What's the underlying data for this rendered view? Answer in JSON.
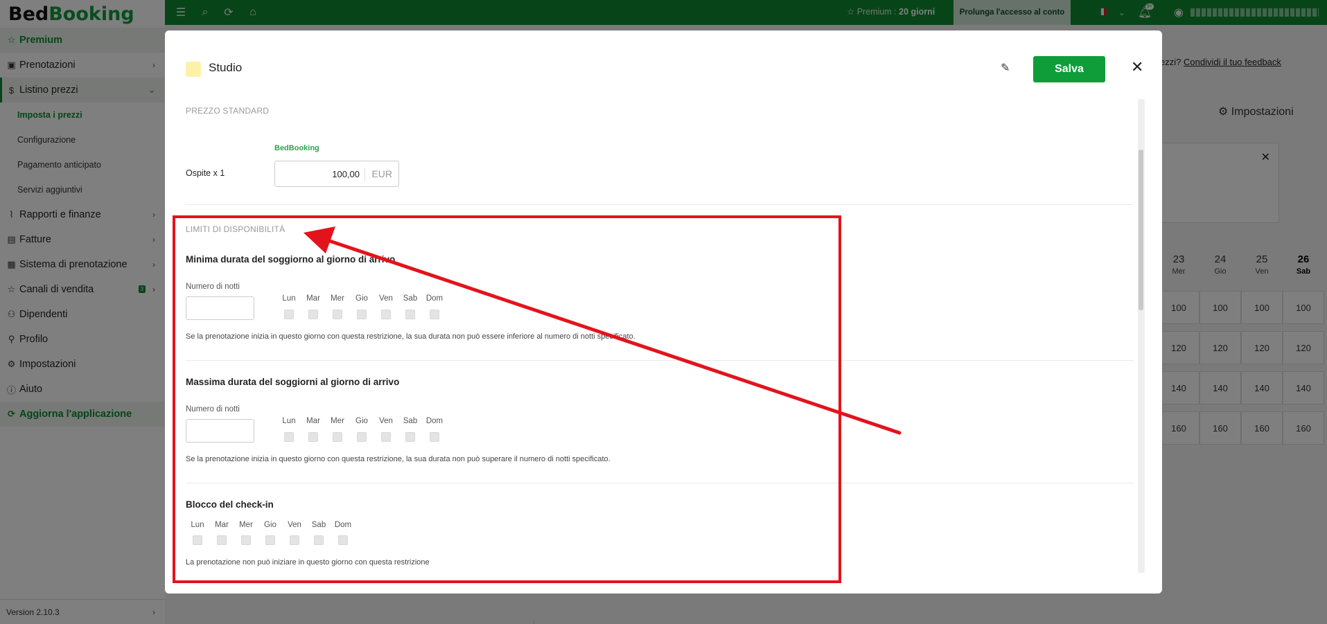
{
  "app": {
    "logo_part1": "Bed",
    "logo_part2": "Booking"
  },
  "sidebar": {
    "premium": "Premium",
    "items": [
      {
        "label": "Prenotazioni"
      },
      {
        "label": "Listino prezzi"
      },
      {
        "label": "Rapporti e finanze"
      },
      {
        "label": "Fatture"
      },
      {
        "label": "Sistema di prenotazione"
      },
      {
        "label": "Canali di vendita",
        "badge": "3"
      },
      {
        "label": "Dipendenti"
      },
      {
        "label": "Profilo"
      },
      {
        "label": "Impostazioni"
      },
      {
        "label": "Aiuto"
      }
    ],
    "subitems": [
      "Imposta i prezzi",
      "Configurazione",
      "Pagamento anticipato",
      "Servizi aggiuntivi"
    ],
    "update": "Aggiorna l'applicazione",
    "version": "Version 2.10.3"
  },
  "topbar": {
    "premium_prefix": "Premium : ",
    "premium_days": "20 giorni",
    "extend_button": "Prolunga l'accesso al conto",
    "notifications_badge": "9+"
  },
  "background": {
    "feedback_prefix": "ezzi?",
    "feedback_link": "Condividi il tuo feedback",
    "settings": "Impostazioni",
    "days": [
      {
        "num": "23",
        "dow": "Mer"
      },
      {
        "num": "24",
        "dow": "Gio"
      },
      {
        "num": "25",
        "dow": "Ven"
      },
      {
        "num": "26",
        "dow": "Sab"
      }
    ],
    "rows": [
      [
        "100",
        "100",
        "100",
        "100"
      ],
      [
        "120",
        "120",
        "120",
        "120"
      ],
      [
        "140",
        "140",
        "140",
        "140"
      ],
      [
        "160",
        "160",
        "160",
        "160"
      ]
    ]
  },
  "modal": {
    "title": "Studio",
    "save": "Salva",
    "standard_price_label": "PREZZO STANDARD",
    "source": "BedBooking",
    "guest_label": "Ospite x 1",
    "price_value": "100,00",
    "currency": "EUR",
    "limits_label": "LIMITI DI DISPONIBILITÀ",
    "days": [
      "Lun",
      "Mar",
      "Mer",
      "Gio",
      "Ven",
      "Sab",
      "Dom"
    ],
    "min_stay": {
      "title": "Minima durata del soggiorno al giorno di arrivo",
      "nights_label": "Numero di notti",
      "hint": "Se la prenotazione inizia in questo giorno con questa restrizione, la sua durata non può essere inferiore al numero di notti specificato."
    },
    "max_stay": {
      "title": "Massima durata del soggiorni al giorno di arrivo",
      "nights_label": "Numero di notti",
      "hint": "Se la prenotazione inizia in questo giorno con questa restrizione, la sua durata non può superare il numero di notti specificato."
    },
    "checkin_block": {
      "title": "Blocco del check-in",
      "hint": "La prenotazione non può iniziare in questo giorno con questa restrizione"
    }
  },
  "annotation_color": "#e3131c",
  "brand_color": "#0f8b30"
}
